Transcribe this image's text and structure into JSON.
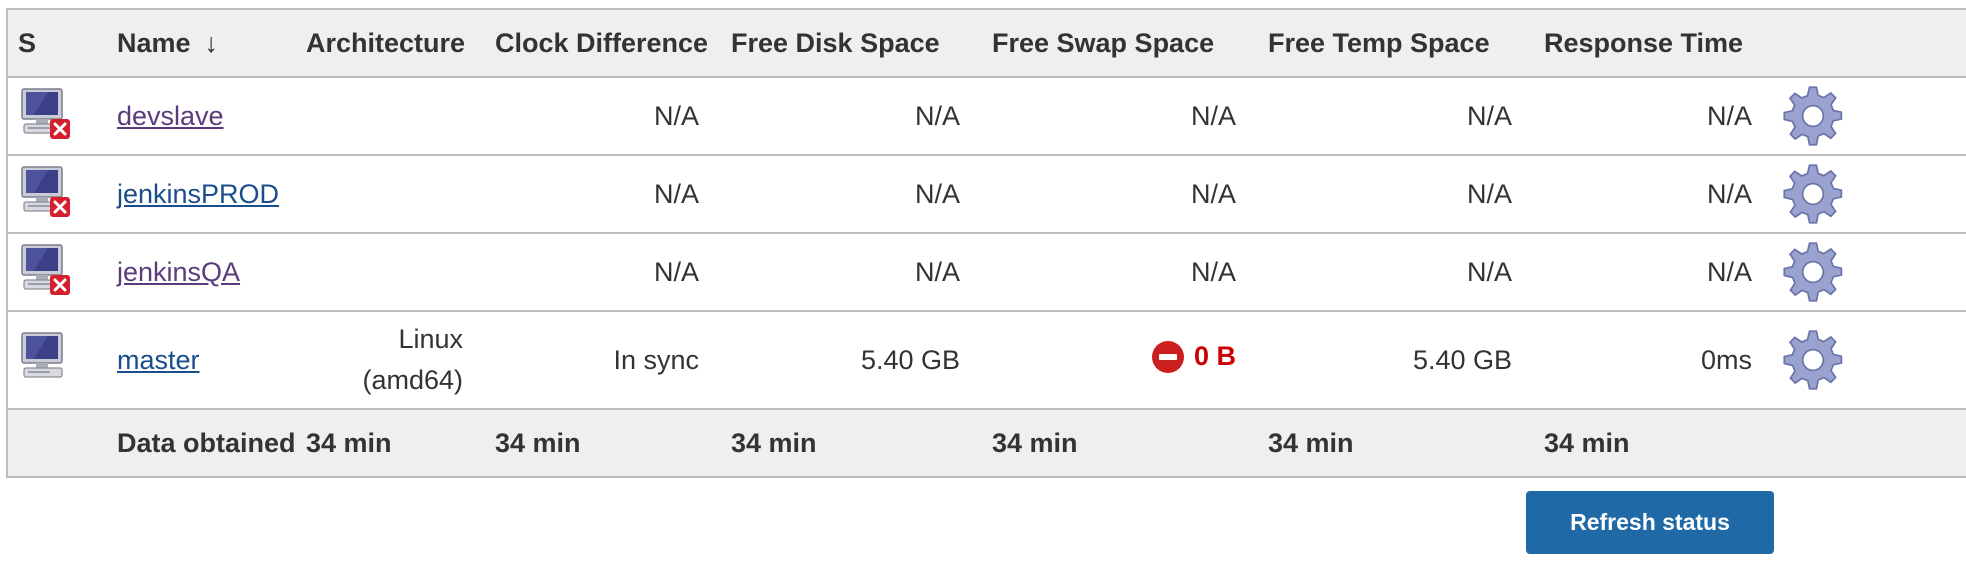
{
  "table": {
    "headers": {
      "status": "S",
      "name": "Name",
      "sort_indicator": "↓",
      "architecture": "Architecture",
      "clock_difference": "Clock Difference",
      "free_disk_space": "Free Disk Space",
      "free_swap_space": "Free Swap Space",
      "free_temp_space": "Free Temp Space",
      "response_time": "Response Time"
    },
    "rows": [
      {
        "status_icon": "computer-offline-icon",
        "name": "devslave",
        "architecture": "",
        "clock_difference": "N/A",
        "free_disk_space": "N/A",
        "free_swap_space": "N/A",
        "free_temp_space": "N/A",
        "response_time": "N/A",
        "configure_icon": "gear-icon"
      },
      {
        "status_icon": "computer-offline-icon",
        "name": "jenkinsPROD",
        "architecture": "",
        "clock_difference": "N/A",
        "free_disk_space": "N/A",
        "free_swap_space": "N/A",
        "free_temp_space": "N/A",
        "response_time": "N/A",
        "configure_icon": "gear-icon"
      },
      {
        "status_icon": "computer-offline-icon",
        "name": "jenkinsQA",
        "architecture": "",
        "clock_difference": "N/A",
        "free_disk_space": "N/A",
        "free_swap_space": "N/A",
        "free_temp_space": "N/A",
        "response_time": "N/A",
        "configure_icon": "gear-icon"
      },
      {
        "status_icon": "computer-online-icon",
        "name": "master",
        "architecture_line1": "Linux",
        "architecture_line2": "(amd64)",
        "clock_difference": "In sync",
        "free_disk_space": "5.40 GB",
        "free_swap_space": "0 B",
        "free_swap_warning_icon": "stop-icon",
        "free_temp_space": "5.40 GB",
        "response_time": "0ms",
        "configure_icon": "gear-icon"
      }
    ],
    "footer": {
      "label": "Data obtained",
      "architecture": "34 min",
      "clock_difference": "34 min",
      "free_disk_space": "34 min",
      "free_swap_space": "34 min",
      "free_temp_space": "34 min",
      "response_time": "34 min"
    }
  },
  "refresh_button": {
    "label": "Refresh status"
  },
  "colors": {
    "link": "#1a4d8c",
    "visited_link": "#5b3b7a",
    "warning": "#cc0000",
    "button": "#1f69a6",
    "header_bg": "#efefef"
  }
}
